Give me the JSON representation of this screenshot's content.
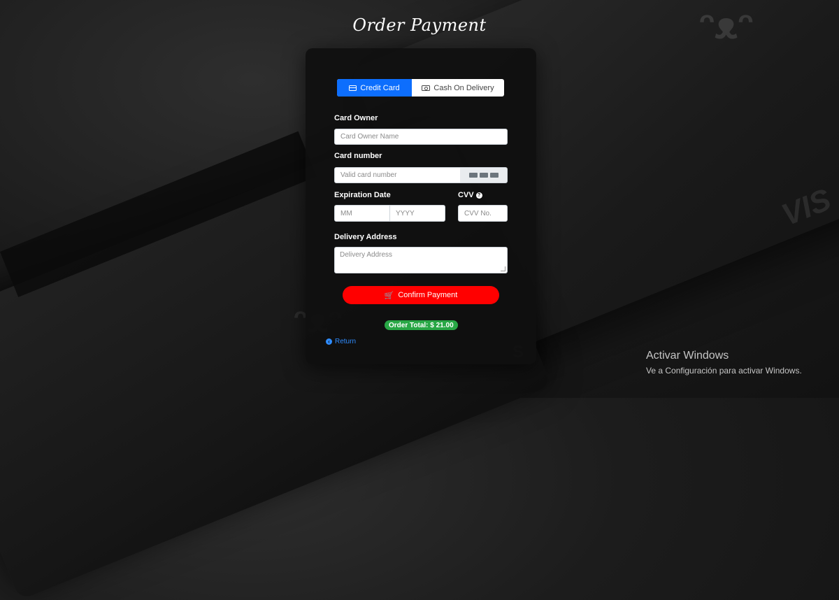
{
  "page": {
    "title": "Order Payment"
  },
  "tabs": {
    "credit_card": {
      "label": "Credit Card",
      "icon": "credit-card-icon",
      "active": true
    },
    "cash_on_delivery": {
      "label": "Cash On Delivery",
      "icon": "money-bill-icon",
      "active": false
    }
  },
  "form": {
    "card_owner": {
      "label": "Card Owner",
      "placeholder": "Card Owner Name",
      "value": ""
    },
    "card_number": {
      "label": "Card number",
      "placeholder": "Valid card number",
      "value": "",
      "card_icons": [
        "visa-icon",
        "mastercard-icon",
        "amex-icon"
      ]
    },
    "expiration": {
      "label": "Expiration Date",
      "month_placeholder": "MM",
      "year_placeholder": "YYYY"
    },
    "cvv": {
      "label": "CVV",
      "placeholder": "CVV No.",
      "help_icon": "question-circle-icon"
    },
    "delivery_address": {
      "label": "Delivery Address",
      "placeholder": "Delivery Address",
      "value": ""
    }
  },
  "actions": {
    "confirm_label": "Confirm Payment",
    "confirm_icon": "shopping-cart-icon",
    "return_label": "Return",
    "return_icon": "arrow-circle-left-icon"
  },
  "order": {
    "total_label": "Order Total: $ 21.00"
  },
  "system": {
    "activate_title": "Activar Windows",
    "activate_subtitle": "Ve a Configuración para activar Windows."
  },
  "colors": {
    "accent": "#0d6efd",
    "confirm": "#ff0000",
    "total_badge": "#28a745",
    "link": "#2f8cff",
    "panel": "#0f0f0f"
  }
}
